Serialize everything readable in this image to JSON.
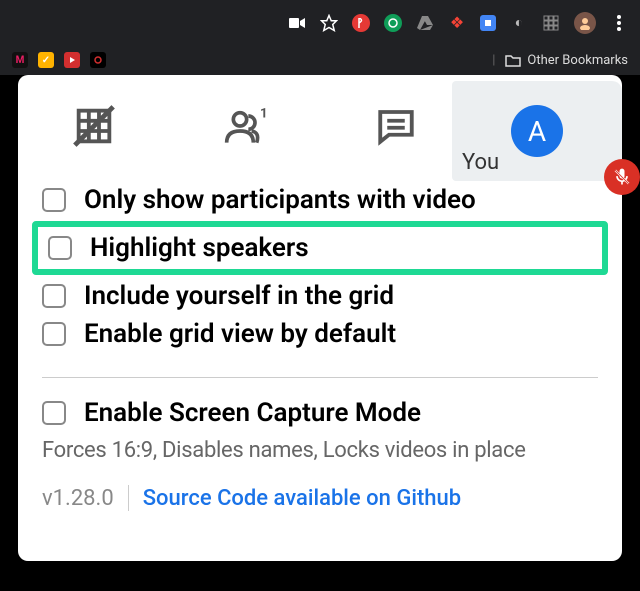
{
  "browser": {
    "other_bookmarks_label": "Other Bookmarks"
  },
  "tile": {
    "you_label": "You",
    "avatar_letter": "A"
  },
  "options": {
    "only_video": "Only show participants with video",
    "highlight_speakers": "Highlight speakers",
    "include_yourself": "Include yourself in the grid",
    "enable_default": "Enable grid view by default",
    "screen_capture": "Enable Screen Capture Mode",
    "screen_capture_desc": "Forces 16:9, Disables names, Locks videos in place"
  },
  "footer": {
    "version": "v1.28.0",
    "source_link": "Source Code available on Github"
  }
}
